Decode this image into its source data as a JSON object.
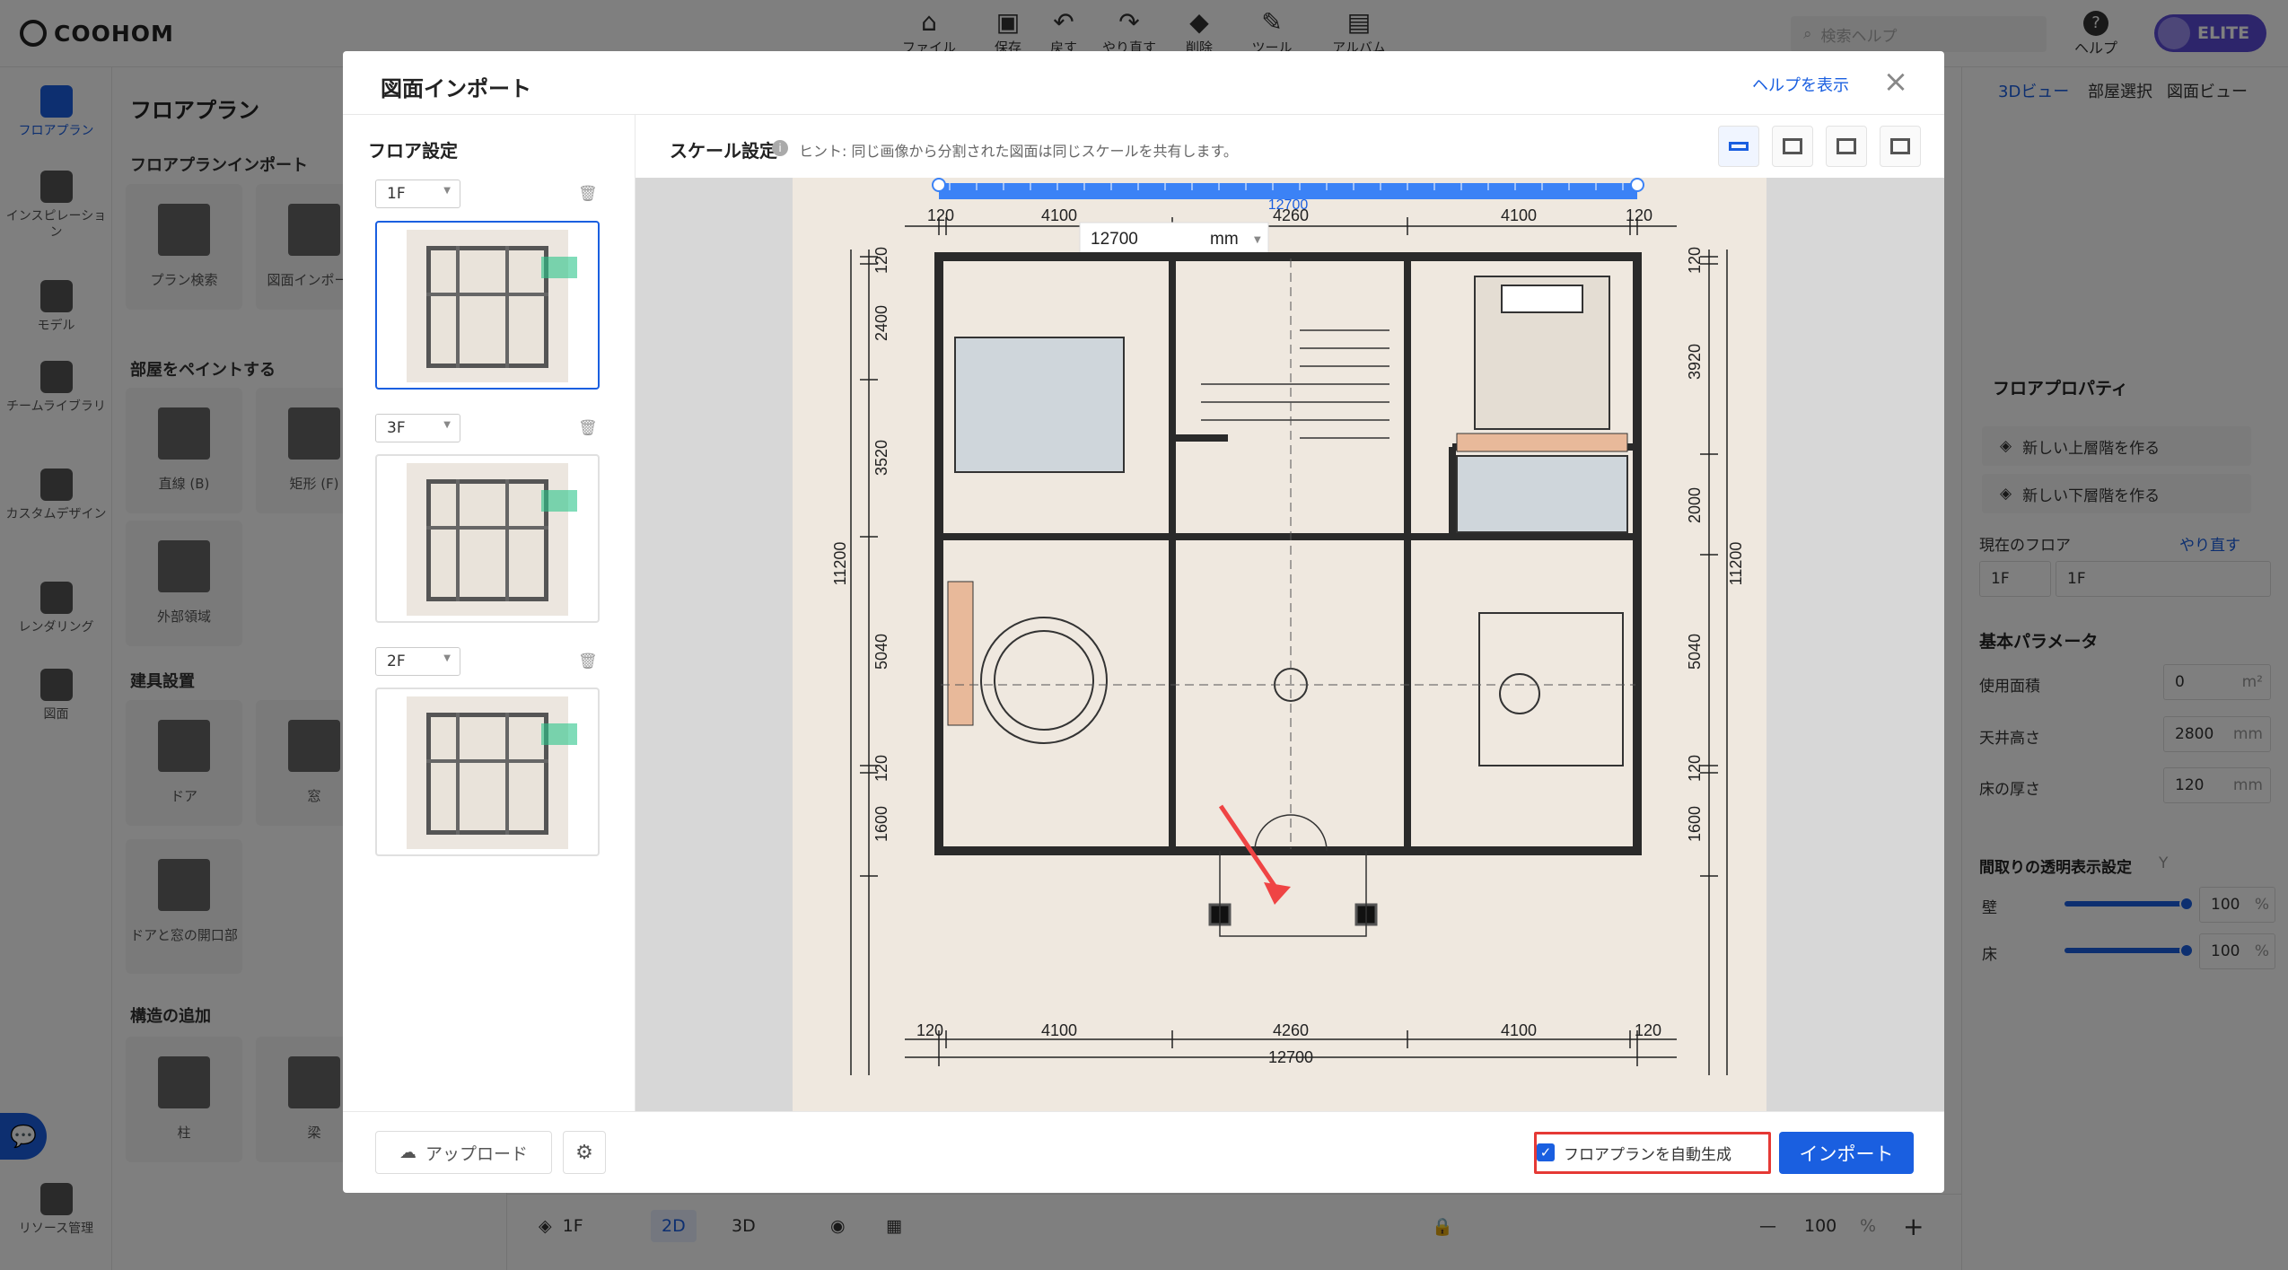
{
  "app": {
    "logo_text": "COOHOM",
    "toolbar": [
      {
        "label": "ファイル",
        "icon": "home-icon"
      },
      {
        "label": "保存",
        "icon": "save-icon"
      },
      {
        "label": "戻す",
        "icon": "undo-icon"
      },
      {
        "label": "やり直す",
        "icon": "redo-icon"
      },
      {
        "label": "削除",
        "icon": "eraser-icon"
      },
      {
        "label": "ツール",
        "icon": "wrench-icon"
      },
      {
        "label": "アルバム",
        "icon": "album-icon"
      }
    ],
    "search_placeholder": "検索ヘルプ",
    "help_label": "ヘルプ",
    "user_badge": "ELITE"
  },
  "left_nav": [
    {
      "label": "フロアプラン",
      "icon": "floorplan-icon",
      "active": true
    },
    {
      "label": "インスピレーション",
      "icon": "bulb-icon",
      "active": false
    },
    {
      "label": "モデル",
      "icon": "sofa-icon",
      "active": false
    },
    {
      "label": "チームライブラリ",
      "icon": "crown-icon",
      "active": false
    },
    {
      "label": "カスタムデザイン",
      "icon": "cube-icon",
      "active": false
    },
    {
      "label": "レンダリング",
      "icon": "camera-icon",
      "active": false
    },
    {
      "label": "図面",
      "icon": "drawing-icon",
      "active": false
    },
    {
      "label": "リソース管理",
      "icon": "resource-icon",
      "active": false
    }
  ],
  "left_panel": {
    "title": "フロアプラン",
    "sections": [
      {
        "title": "フロアプランインポート",
        "items": [
          "プラン検索",
          "図面インポート"
        ]
      },
      {
        "title": "部屋をペイントする",
        "items": [
          "直線 (B)",
          "矩形 (F)",
          "外部領域"
        ]
      },
      {
        "title": "建具設置",
        "items": [
          "ドア",
          "窓",
          "ドアと窓の開口部"
        ]
      },
      {
        "title": "構造の追加",
        "items": [
          "柱",
          "梁"
        ]
      }
    ]
  },
  "right_panel": {
    "tabs": [
      "3Dビュー",
      "部屋選択",
      "図面ビュー"
    ],
    "properties_title": "フロアプロパティ",
    "new_upper": "新しい上層階を作る",
    "new_lower": "新しい下層階を作る",
    "current_floor_label": "現在のフロア",
    "redo_label": "やり直す",
    "current_floor_prefix": "1F",
    "current_floor_value": "1F",
    "basic_params": "基本パラメータ",
    "area_label": "使用面積",
    "area_value": "0",
    "area_unit": "m²",
    "ceiling_label": "天井高さ",
    "ceiling_value": "2800",
    "ceiling_unit": "mm",
    "floor_thick_label": "床の厚さ",
    "floor_thick_value": "120",
    "floor_thick_unit": "mm",
    "transparency_title": "間取りの透明表示設定",
    "transparency_hotkey": "Y",
    "wall_label": "壁",
    "wall_value": "100",
    "floor_label": "床",
    "floor_value": "100",
    "percent": "%"
  },
  "bottom_bar": {
    "floor": "1F",
    "mode_2d": "2D",
    "mode_3d": "3D",
    "zoom": "100",
    "zoom_unit": "%"
  },
  "modal": {
    "title": "図面インポート",
    "help_link": "ヘルプを表示",
    "floor_settings_title": "フロア設定",
    "floors": [
      {
        "name": "1F",
        "active": true
      },
      {
        "name": "3F",
        "active": false
      },
      {
        "name": "2F",
        "active": false
      }
    ],
    "scale_title": "スケール設定",
    "hint": "ヒント: 同じ画像から分割された図面は同じスケールを共有します。",
    "ruler_value": "12700",
    "scale_input_value": "12700",
    "scale_unit": "mm",
    "upload_label": "アップロード",
    "auto_generate_label": "フロアプランを自動生成",
    "auto_generate_checked": true,
    "import_label": "インポート"
  },
  "blueprint": {
    "top_dims": [
      "120",
      "4100",
      "4260",
      "4100",
      "120"
    ],
    "bottom_dims": [
      "120",
      "4100",
      "4260",
      "4100",
      "120"
    ],
    "bottom_total": "12700",
    "left_dims": [
      "120",
      "2400",
      "3520",
      "5040",
      "120",
      "1600"
    ],
    "left_total": "11200",
    "right_dims": [
      "120",
      "3920",
      "2000",
      "5040",
      "120",
      "1600"
    ],
    "right_total": "11200"
  }
}
